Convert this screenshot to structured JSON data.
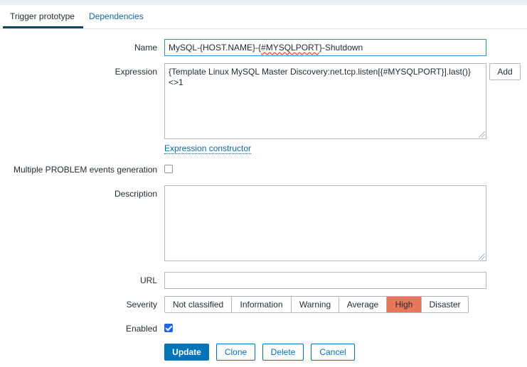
{
  "tabs": [
    {
      "label": "Trigger prototype",
      "active": true
    },
    {
      "label": "Dependencies",
      "active": false
    }
  ],
  "form": {
    "name": {
      "label": "Name",
      "value_pre": "MySQL-{HOST.NAME}-{",
      "value_macro": "#MYSQLPORT",
      "value_post": "}-Shutdown"
    },
    "expression": {
      "label": "Expression",
      "value": "{Template Linux MySQL Master Discovery:net.tcp.listen[{#MYSQLPORT}].last()}<>1",
      "add_label": "Add",
      "constructor_link": "Expression constructor"
    },
    "multiple_problem": {
      "label": "Multiple PROBLEM events generation",
      "checked": false
    },
    "description": {
      "label": "Description",
      "value": ""
    },
    "url": {
      "label": "URL",
      "value": ""
    },
    "severity": {
      "label": "Severity",
      "options": [
        "Not classified",
        "Information",
        "Warning",
        "Average",
        "High",
        "Disaster"
      ],
      "selected": "High",
      "selected_color": "#e97659"
    },
    "enabled": {
      "label": "Enabled",
      "checked": true
    }
  },
  "buttons": {
    "update": "Update",
    "clone": "Clone",
    "delete": "Delete",
    "cancel": "Cancel"
  },
  "colors": {
    "accent": "#0275b8",
    "link": "#0a6aa1",
    "checkbox_checked": "#1f65f4"
  }
}
